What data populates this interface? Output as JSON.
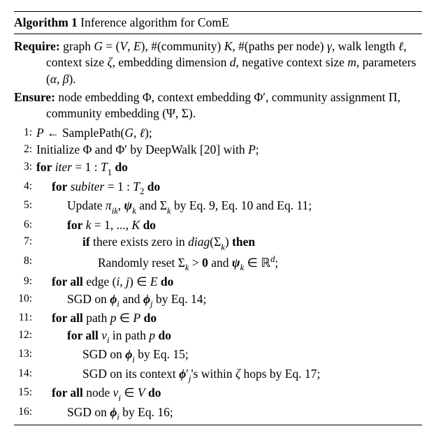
{
  "algorithm": {
    "number": "Algorithm 1",
    "title": "Inference algorithm for ComE",
    "require_label": "Require:",
    "require_text": "graph G = (V, E), #(community) K, #(paths per node) γ, walk length ℓ, context size ζ, embedding dimension d, negative context size m, parameters (α, β).",
    "ensure_label": "Ensure:",
    "ensure_text": "node embedding Φ, context embedding Φ′, community assignment Π, community embedding (Ψ, Σ).",
    "steps": [
      {
        "n": "1:",
        "indent": 1,
        "text": "𝒫 ← SamplePath(G, ℓ);"
      },
      {
        "n": "2:",
        "indent": 1,
        "text": "Initialize Φ and Φ′ by DeepWalk [20] with 𝒫;"
      },
      {
        "n": "3:",
        "indent": 1,
        "text": "for iter = 1 : T₁ do"
      },
      {
        "n": "4:",
        "indent": 2,
        "text": "for subiter = 1 : T₂ do"
      },
      {
        "n": "5:",
        "indent": 3,
        "text": "Update πᵢₖ, ψₖ and Σₖ by Eq. 9, Eq. 10 and Eq. 11;"
      },
      {
        "n": "6:",
        "indent": 3,
        "text": "for k = 1, ..., K do"
      },
      {
        "n": "7:",
        "indent": 4,
        "text": "if there exists zero in diag(Σₖ) then"
      },
      {
        "n": "8:",
        "indent": 5,
        "text": "Randomly reset Σₖ > 0 and ψₖ ∈ ℝᵈ;"
      },
      {
        "n": "9:",
        "indent": 2,
        "text": "for all edge (i, j) ∈ E do"
      },
      {
        "n": "10:",
        "indent": 3,
        "text": "SGD on ϕᵢ and ϕⱼ by Eq. 14;"
      },
      {
        "n": "11:",
        "indent": 2,
        "text": "for all path p ∈ 𝒫 do"
      },
      {
        "n": "12:",
        "indent": 3,
        "text": "for all vᵢ in path p do"
      },
      {
        "n": "13:",
        "indent": 4,
        "text": "SGD on ϕᵢ by Eq. 15;"
      },
      {
        "n": "14:",
        "indent": 4,
        "text": "SGD on its context ϕ′ⱼ's within ζ hops by Eq. 17;"
      },
      {
        "n": "15:",
        "indent": 2,
        "text": "for all node vᵢ ∈ V do"
      },
      {
        "n": "16:",
        "indent": 3,
        "text": "SGD on ϕᵢ by Eq. 16;"
      }
    ]
  }
}
